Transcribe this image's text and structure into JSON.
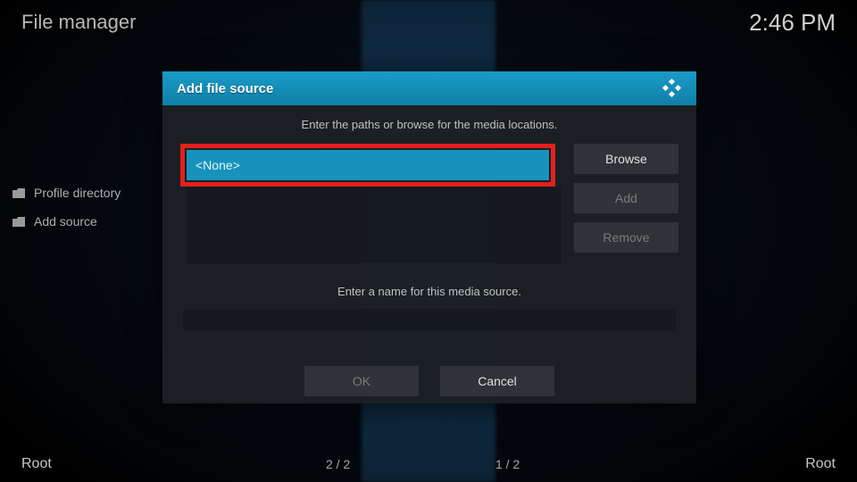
{
  "header": {
    "title": "File manager",
    "clock": "2:46 PM"
  },
  "sidebar": {
    "items": [
      {
        "label": "Profile directory"
      },
      {
        "label": "Add source"
      }
    ]
  },
  "footer": {
    "left_label": "Root",
    "right_label": "Root",
    "left_pager": "2 / 2",
    "right_pager": "1 / 2"
  },
  "dialog": {
    "title": "Add file source",
    "instruction_paths": "Enter the paths or browse for the media locations.",
    "path_value": "<None>",
    "buttons": {
      "browse": "Browse",
      "add": "Add",
      "remove": "Remove"
    },
    "instruction_name": "Enter a name for this media source.",
    "name_value": "",
    "ok": "OK",
    "cancel": "Cancel"
  }
}
